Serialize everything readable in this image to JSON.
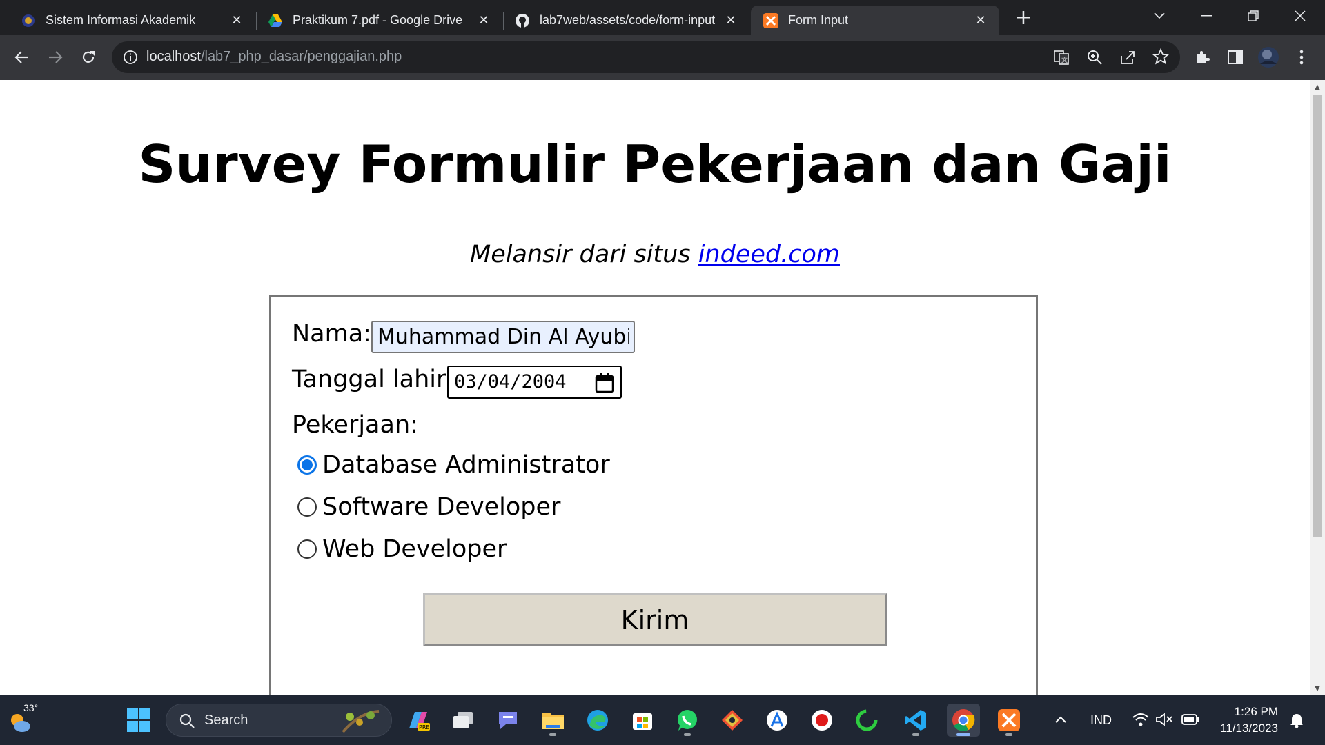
{
  "browser": {
    "tabs": [
      {
        "title": "Sistem Informasi Akademik",
        "icon": "university-icon",
        "active": false
      },
      {
        "title": "Praktikum 7.pdf - Google Drive",
        "icon": "google-drive-icon",
        "active": false
      },
      {
        "title": "lab7web/assets/code/form-input",
        "icon": "github-icon",
        "active": false
      },
      {
        "title": "Form Input",
        "icon": "xampp-icon",
        "active": true
      }
    ],
    "url_host": "localhost",
    "url_path": "/lab7_php_dasar/penggajian.php"
  },
  "page": {
    "title": "Survey Formulir Pekerjaan dan Gaji",
    "subtitle_prefix": "Melansir dari situs ",
    "subtitle_link": "indeed.com",
    "form": {
      "name_label": "Nama:",
      "name_value": "Muhammad Din Al Ayubi",
      "dob_label": "Tanggal lahir:",
      "dob_value": "03/04/2004",
      "job_label": "Pekerjaan:",
      "jobs": [
        {
          "label": "Database Administrator",
          "checked": true
        },
        {
          "label": "Software Developer",
          "checked": false
        },
        {
          "label": "Web Developer",
          "checked": false
        }
      ],
      "submit_label": "Kirim"
    }
  },
  "taskbar": {
    "weather": "33°",
    "search_placeholder": "Search",
    "pinned_icons": [
      "copilot-icon",
      "task-view-icon",
      "teams-chat-icon",
      "file-explorer-icon",
      "edge-icon",
      "store-icon",
      "whatsapp-icon",
      "git-icon",
      "autodesk-icon",
      "recorder-icon",
      "refresh-app-icon",
      "vscode-icon",
      "chrome-icon",
      "xampp-icon"
    ],
    "language": "IND",
    "time": "1:26 PM",
    "date": "11/13/2023"
  },
  "colors": {
    "accent": "#0b74e8",
    "link": "#0000ee",
    "autofill": "#e8f0fe",
    "button": "#ded9cc"
  }
}
